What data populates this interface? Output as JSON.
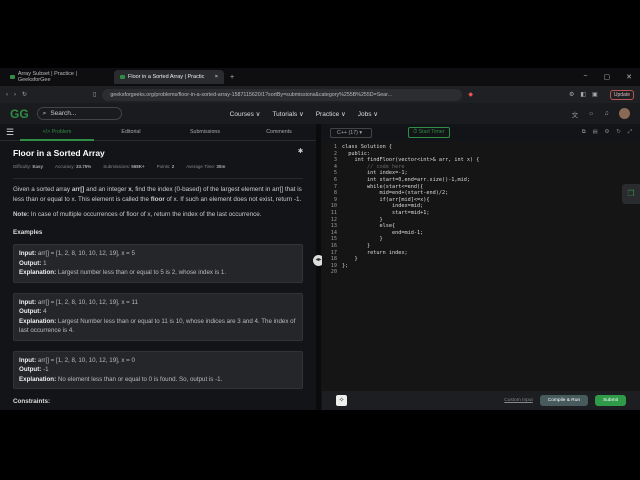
{
  "browser": {
    "tabs": [
      {
        "label": "Array Subset | Practice | GeeksforGee"
      },
      {
        "label": "Floor in a Sorted Array | Practic",
        "close": "×"
      }
    ],
    "new_tab": "+",
    "url": "geeksforgeeks.org/problems/floor-in-a-sorted-array-1587115620/1?sortBy=submissions&category%255B%255D=Sear...",
    "update_label": "Update"
  },
  "site": {
    "logo": "GG",
    "search_placeholder": "Search...",
    "nav": [
      "Courses ∨",
      "Tutorials ∨",
      "Practice ∨",
      "Jobs ∨"
    ]
  },
  "left": {
    "tabs": [
      "</> Problem",
      "Editorial",
      "Submissions",
      "Comments"
    ],
    "title": "Floor in a Sorted Array",
    "meta": {
      "difficulty_label": "Difficulty:",
      "difficulty": "Easy",
      "accuracy_label": "Accuracy:",
      "accuracy": "33.75%",
      "submissions_label": "Submissions:",
      "submissions": "568K+",
      "points_label": "Points:",
      "points": "2",
      "time_label": "Average Time:",
      "time": "30m"
    },
    "desc1": "Given a sorted array",
    "desc_arr": "arr[]",
    "desc2": "and an integer",
    "desc_x": "x",
    "desc3": ", find the index (0-based) of the largest element in arr[] that is less than or equal to x. This element is called the",
    "desc_floor": "floor",
    "desc4": "of x. If such an element does not exist, return -1.",
    "note_label": "Note:",
    "note": "In case of multiple occurrences of floor of x, return the index of the last occurrence.",
    "examples_heading": "Examples",
    "examples": [
      {
        "input": "arr[] = [1, 2, 8, 10, 10, 12, 19], x = 5",
        "output": "1",
        "explanation": "Largest number less than or equal to 5 is 2, whose index is 1."
      },
      {
        "input": "arr[] = [1, 2, 8, 10, 10, 12, 19], x = 11",
        "output": "4",
        "explanation": "Largest Number less than or equal to 11 is 10, whose indices are 3 and 4. The index of last occurrence is 4."
      },
      {
        "input": "arr[] = [1, 2, 8, 10, 10, 12, 19], x = 0",
        "output": "-1",
        "explanation": "No element less than or equal to 0 is found. So, output is -1."
      }
    ],
    "labels": {
      "input": "Input:",
      "output": "Output:",
      "explanation": "Explanation:"
    },
    "constraints_heading": "Constraints:"
  },
  "editor": {
    "language": "C++ (17)",
    "timer": "Start Timer",
    "lines": [
      "class Solution {",
      "  public:",
      "    int findFloor(vector<int>& arr, int x) {",
      "        // code here",
      "        int index=-1;",
      "        int start=0,end=arr.size()-1,mid;",
      "        while(start<=end){",
      "            mid=end+(start-end)/2;",
      "            if(arr[mid]<=x){",
      "                index=mid;",
      "                start=mid+1;",
      "            }",
      "            else{",
      "                end=mid-1;",
      "            }",
      "        }",
      "        return index;",
      "    }",
      "};",
      ""
    ],
    "custom_input": "Custom Input",
    "compile": "Compile & Run",
    "submit": "Submit"
  },
  "colors": {
    "accent": "#2f8d46",
    "submit": "#2f9a47",
    "compile": "#475b5d"
  }
}
